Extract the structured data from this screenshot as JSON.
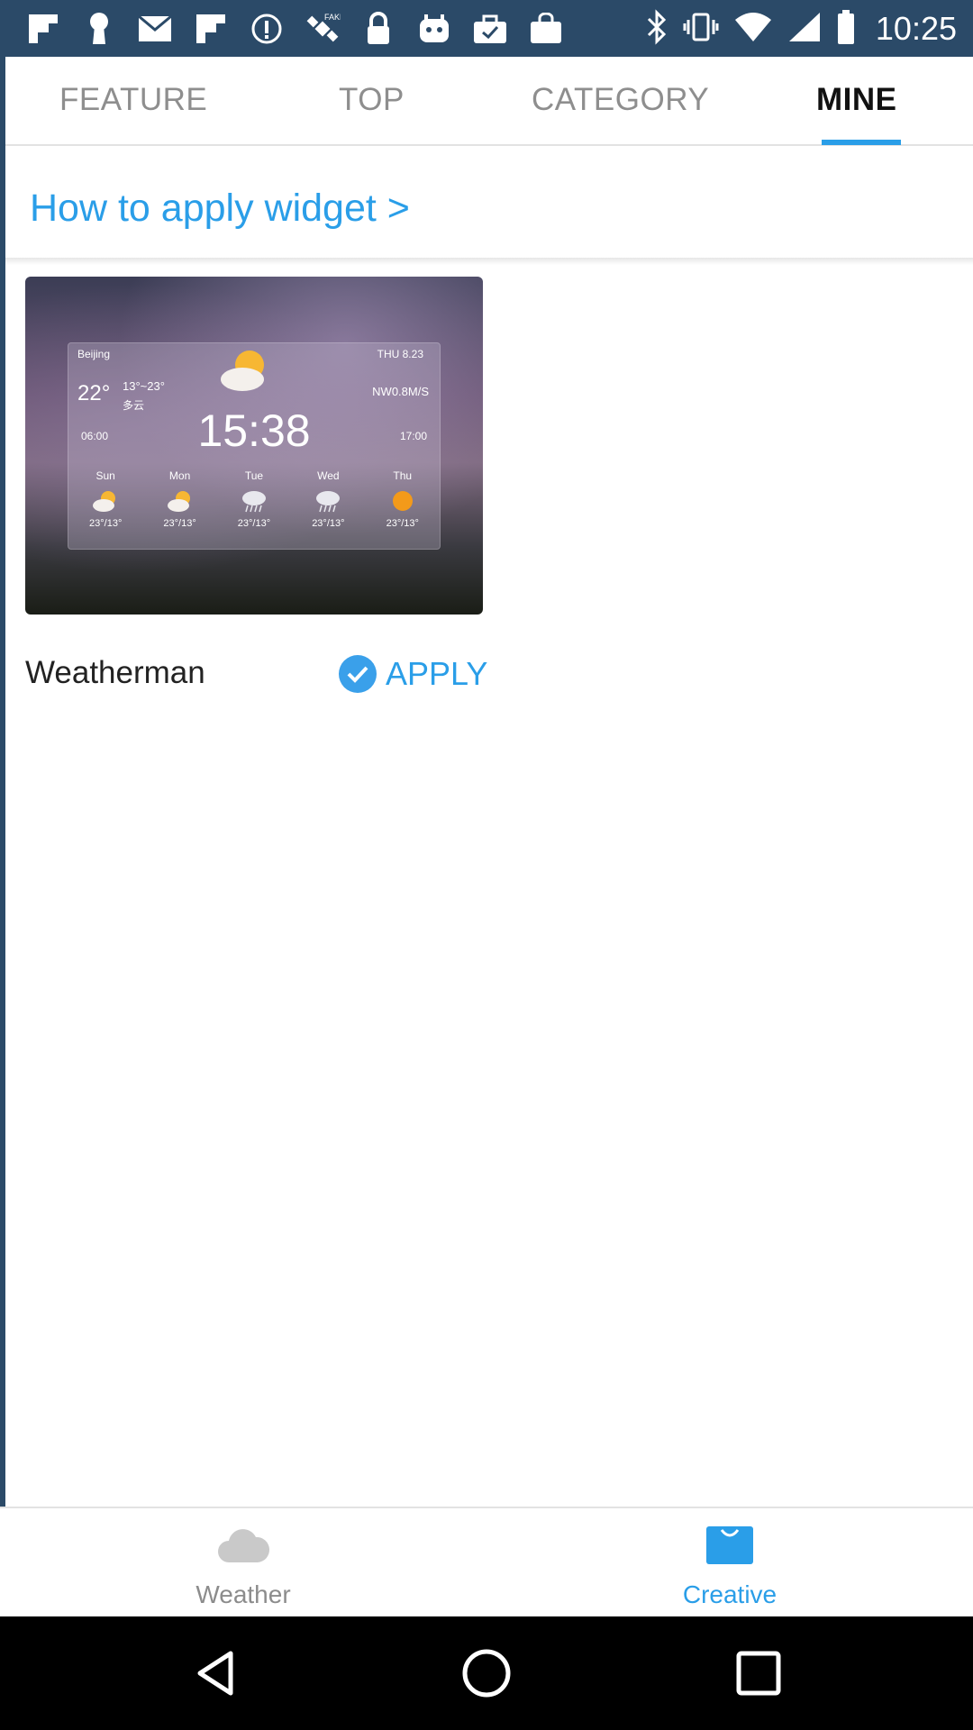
{
  "statusbar": {
    "time": "10:25",
    "left_icons": [
      "flipboard-icon",
      "keyhole-icon",
      "mail-icon",
      "flipboard-icon-2",
      "info-icon",
      "fake-gps-icon",
      "lock-icon",
      "game-controller-icon",
      "briefcase-check-icon",
      "shopping-bag-icon"
    ],
    "right_icons": [
      "bluetooth-icon",
      "vibrate-icon",
      "wifi-icon",
      "signal-icon",
      "battery-icon"
    ],
    "colors": {
      "background": "#2b4a68"
    }
  },
  "tabs": {
    "items": [
      {
        "label": "FEATURE",
        "active": false
      },
      {
        "label": "TOP",
        "active": false
      },
      {
        "label": "CATEGORY",
        "active": false
      },
      {
        "label": "MINE",
        "active": true
      }
    ],
    "colors": {
      "accent": "#2a9ee8"
    }
  },
  "howto": {
    "label": "How to apply widget >"
  },
  "widget_card": {
    "name": "Weatherman",
    "apply_label": "APPLY",
    "preview": {
      "city": "Beijing",
      "date": "THU 8.23",
      "temperature": "22°",
      "range": "13°~23°",
      "description": "多云",
      "wind": "NW0.8M/S",
      "clock": "15:38",
      "sunrise": "06:00",
      "sunset": "17:00",
      "days": [
        {
          "name": "Sun",
          "temp": "23°/13°",
          "icon": "partly-cloudy-icon"
        },
        {
          "name": "Mon",
          "temp": "23°/13°",
          "icon": "partly-cloudy-icon"
        },
        {
          "name": "Tue",
          "temp": "23°/13°",
          "icon": "rain-icon"
        },
        {
          "name": "Wed",
          "temp": "23°/13°",
          "icon": "rain-icon"
        },
        {
          "name": "Thu",
          "temp": "23°/13°",
          "icon": "sun-icon"
        }
      ]
    }
  },
  "bottomnav": {
    "items": [
      {
        "label": "Weather",
        "icon": "cloud-icon",
        "active": false
      },
      {
        "label": "Creative",
        "icon": "shopping-bag-icon",
        "active": true
      }
    ]
  },
  "sysnav": {
    "icons": [
      "back-icon",
      "home-icon",
      "recents-icon"
    ]
  }
}
